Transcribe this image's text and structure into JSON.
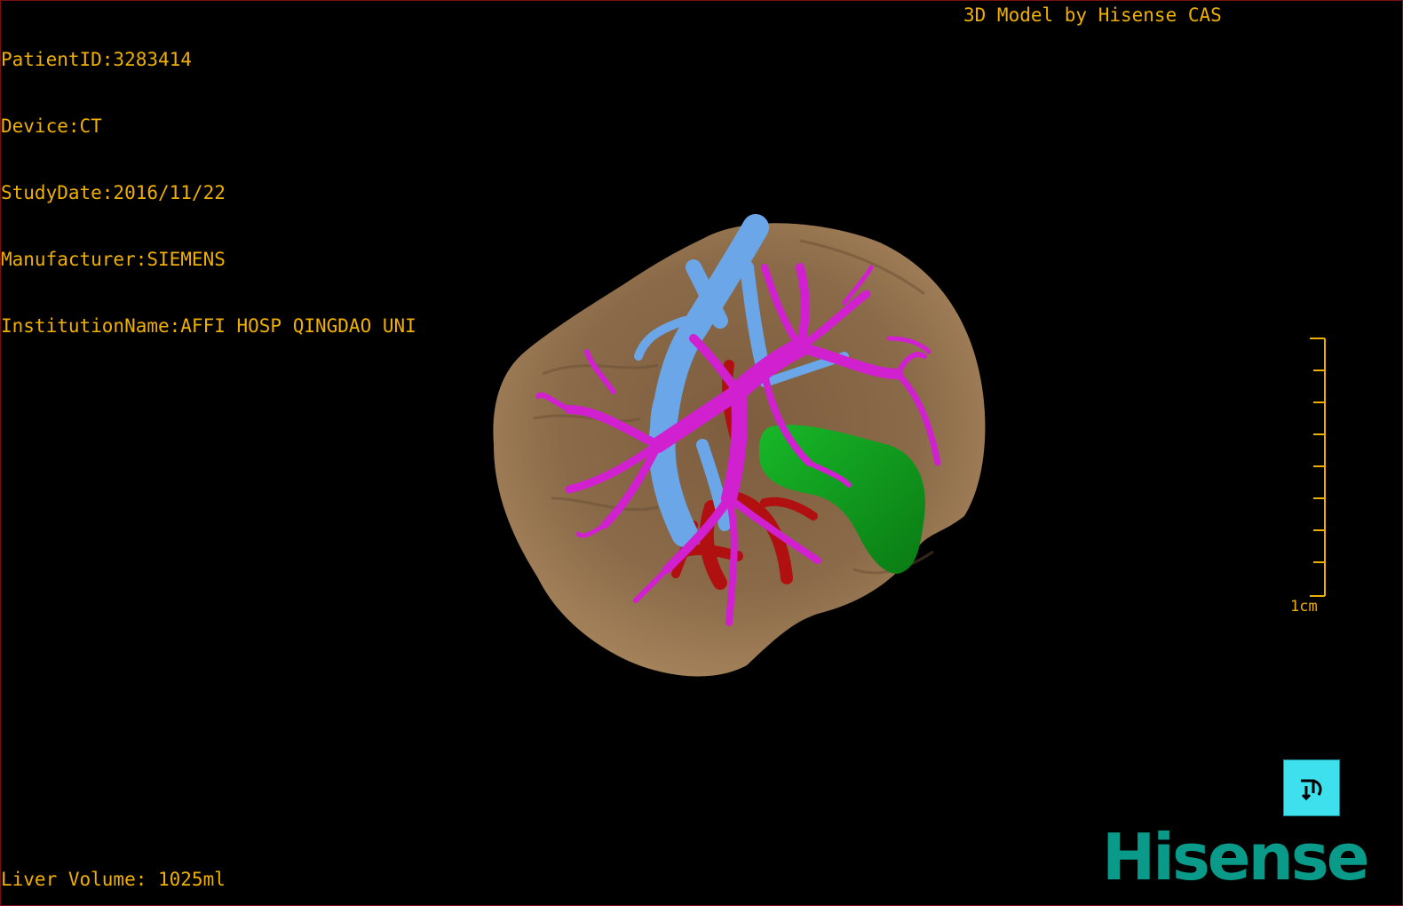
{
  "patient_info": {
    "patient_id": "PatientID:3283414",
    "device": "Device:CT",
    "study_date": "StudyDate:2016/11/22",
    "manufacturer": "Manufacturer:SIEMENS",
    "institution": "InstitutionName:AFFI HOSP QINGDAO UNI"
  },
  "credit": "3D Model by Hisense CAS",
  "liver_volume": "Liver Volume: 1025ml",
  "scale_bar": {
    "label": "1cm"
  },
  "logo": {
    "text": "Hisense"
  },
  "colors": {
    "overlay_text": "#f0b000",
    "liver": "#8a6a48",
    "hepatic_vein": "#6aa6e8",
    "portal_vein": "#d020d0",
    "artery": "#b01010",
    "tumor": "#10a020",
    "logo": "#0a9a8a",
    "reset_button": "#3ee0ee"
  },
  "icons": {
    "reset_view": "reset-view-icon"
  }
}
